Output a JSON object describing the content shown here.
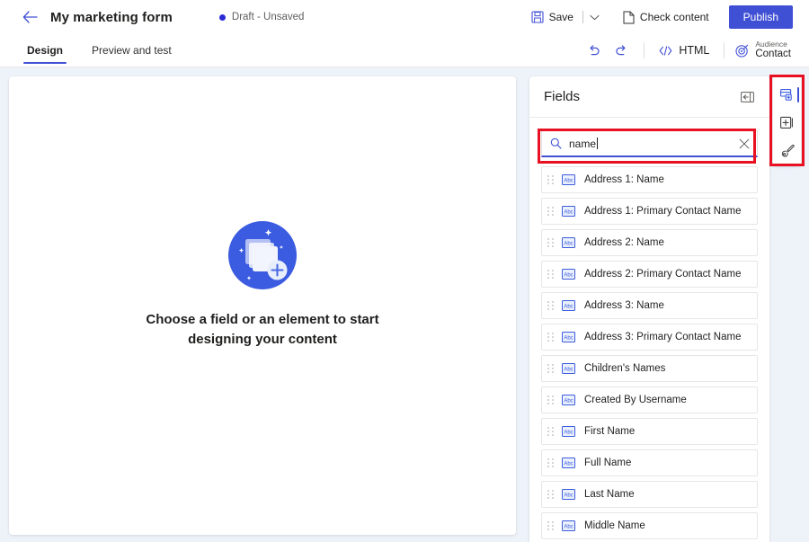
{
  "topbar": {
    "back_icon": "arrow-left-icon",
    "title": "My marketing form",
    "status": "Draft - Unsaved",
    "status_dot_color": "#2b2bd4",
    "save_label": "Save",
    "save_icon": "save-disk-icon",
    "save_caret_icon": "chevron-down-icon",
    "check_content_label": "Check content",
    "check_content_icon": "document-icon",
    "publish_label": "Publish",
    "publish_color": "#4050d4"
  },
  "tabbar": {
    "tabs": [
      {
        "label": "Design",
        "active": true
      },
      {
        "label": "Preview and test",
        "active": false
      }
    ],
    "undo_icon": "undo-icon",
    "redo_icon": "redo-icon",
    "html_label": "HTML",
    "html_icon": "code-brackets-icon",
    "audience_icon": "target-icon",
    "audience_small": "Audience",
    "audience_big": "Contact"
  },
  "canvas": {
    "empty_icon": "stacked-cards-plus-icon",
    "empty_title": "Choose a field or an element to start designing your content"
  },
  "fields_panel": {
    "title": "Fields",
    "collapse_icon": "collapse-panel-icon",
    "search": {
      "icon": "search-icon",
      "value": "name",
      "clear_icon": "close-icon"
    },
    "items": [
      {
        "label": "Address 1: Name",
        "icon": "abc-text-field-icon"
      },
      {
        "label": "Address 1: Primary Contact Name",
        "icon": "abc-text-field-icon"
      },
      {
        "label": "Address 2: Name",
        "icon": "abc-text-field-icon"
      },
      {
        "label": "Address 2: Primary Contact Name",
        "icon": "abc-text-field-icon"
      },
      {
        "label": "Address 3: Name",
        "icon": "abc-text-field-icon"
      },
      {
        "label": "Address 3: Primary Contact Name",
        "icon": "abc-text-field-icon"
      },
      {
        "label": "Children's Names",
        "icon": "abc-text-field-icon"
      },
      {
        "label": "Created By Username",
        "icon": "abc-text-field-icon"
      },
      {
        "label": "First Name",
        "icon": "abc-text-field-icon"
      },
      {
        "label": "Full Name",
        "icon": "abc-text-field-icon"
      },
      {
        "label": "Last Name",
        "icon": "abc-text-field-icon"
      },
      {
        "label": "Middle Name",
        "icon": "abc-text-field-icon"
      }
    ]
  },
  "rail": {
    "buttons": [
      {
        "icon": "fields-panel-icon",
        "active": true
      },
      {
        "icon": "add-element-icon",
        "active": false
      },
      {
        "icon": "style-brush-icon",
        "active": false
      }
    ]
  },
  "annotations": {
    "color": "#e81123",
    "search_box": "highlight-search-box",
    "rail": "highlight-right-rail"
  }
}
